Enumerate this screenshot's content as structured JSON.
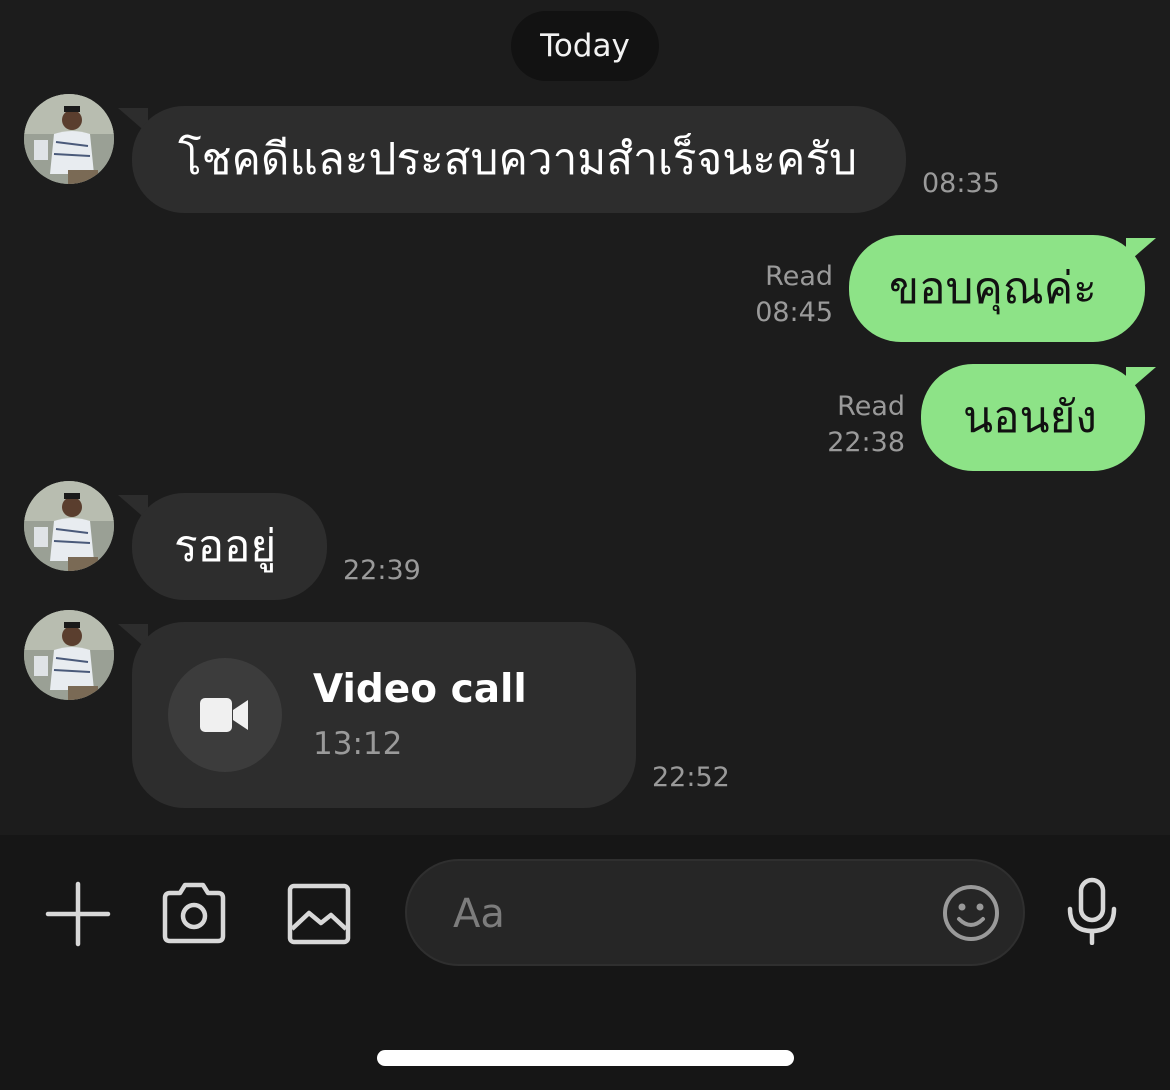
{
  "date_label": "Today",
  "messages": [
    {
      "direction": "incoming",
      "text": "โชคดีและประสบความสำเร็จนะครับ",
      "time": "08:35"
    },
    {
      "direction": "outgoing",
      "text": "ขอบคุณค่ะ",
      "status": "Read",
      "time": "08:45"
    },
    {
      "direction": "outgoing",
      "text": "นอนยัง",
      "status": "Read",
      "time": "22:38"
    },
    {
      "direction": "incoming",
      "text": "รออยู่",
      "time": "22:39"
    },
    {
      "direction": "incoming",
      "type": "video-call",
      "title": "Video call",
      "duration": "13:12",
      "time": "22:52"
    }
  ],
  "composer": {
    "placeholder": "Aa",
    "icons": [
      "plus-icon",
      "camera-icon",
      "image-icon",
      "emoji-icon",
      "microphone-icon"
    ]
  },
  "colors": {
    "background": "#1c1c1c",
    "incoming_bubble": "#2d2d2d",
    "outgoing_bubble": "#8de387",
    "timestamp": "#9a9a9a"
  }
}
